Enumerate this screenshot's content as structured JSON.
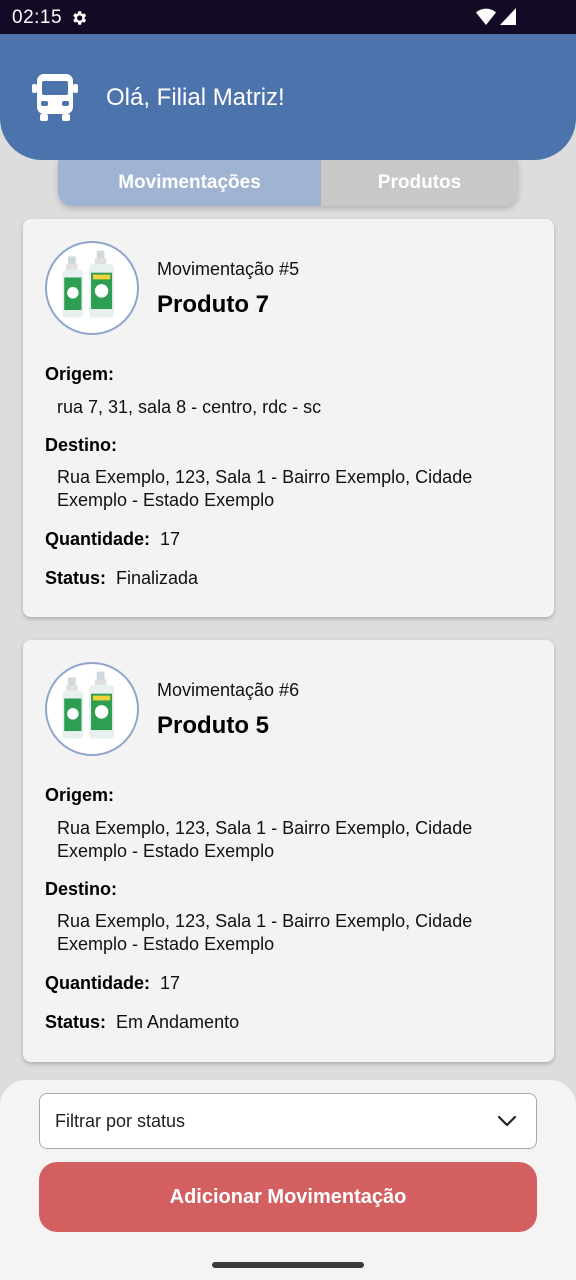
{
  "status_bar": {
    "time": "02:15",
    "icons": [
      "gear-icon",
      "wifi-icon",
      "signal-icon"
    ]
  },
  "header": {
    "icon": "truck-icon",
    "title": "Olá, Filial Matriz!"
  },
  "tabs": [
    {
      "label": "Movimentações",
      "active": true
    },
    {
      "label": "Produtos",
      "active": false
    }
  ],
  "movements": [
    {
      "id_label": "Movimentação #5",
      "product": "Produto 7",
      "origin_label": "Origem:",
      "origin": "rua 7, 31, sala 8 - centro, rdc - sc",
      "destination_label": "Destino:",
      "destination": "Rua Exemplo, 123, Sala 1 - Bairro Exemplo, Cidade Exemplo - Estado Exemplo",
      "quantity_label": "Quantidade:",
      "quantity": "17",
      "status_label": "Status:",
      "status": "Finalizada"
    },
    {
      "id_label": "Movimentação #6",
      "product": "Produto 5",
      "origin_label": "Origem:",
      "origin": "Rua Exemplo, 123, Sala 1 - Bairro Exemplo, Cidade Exemplo - Estado Exemplo",
      "destination_label": "Destino:",
      "destination": "Rua Exemplo, 123, Sala 1 - Bairro Exemplo, Cidade Exemplo - Estado Exemplo",
      "quantity_label": "Quantidade:",
      "quantity": "17",
      "status_label": "Status:",
      "status": "Em Andamento"
    }
  ],
  "filter": {
    "selected": "Filtrar por status"
  },
  "actions": {
    "add_label": "Adicionar Movimentação"
  },
  "colors": {
    "header": "#4d73ad",
    "tab_active": "#9fb4d3",
    "tab_inactive": "#c8c8c8",
    "add_button": "#d45f61"
  }
}
